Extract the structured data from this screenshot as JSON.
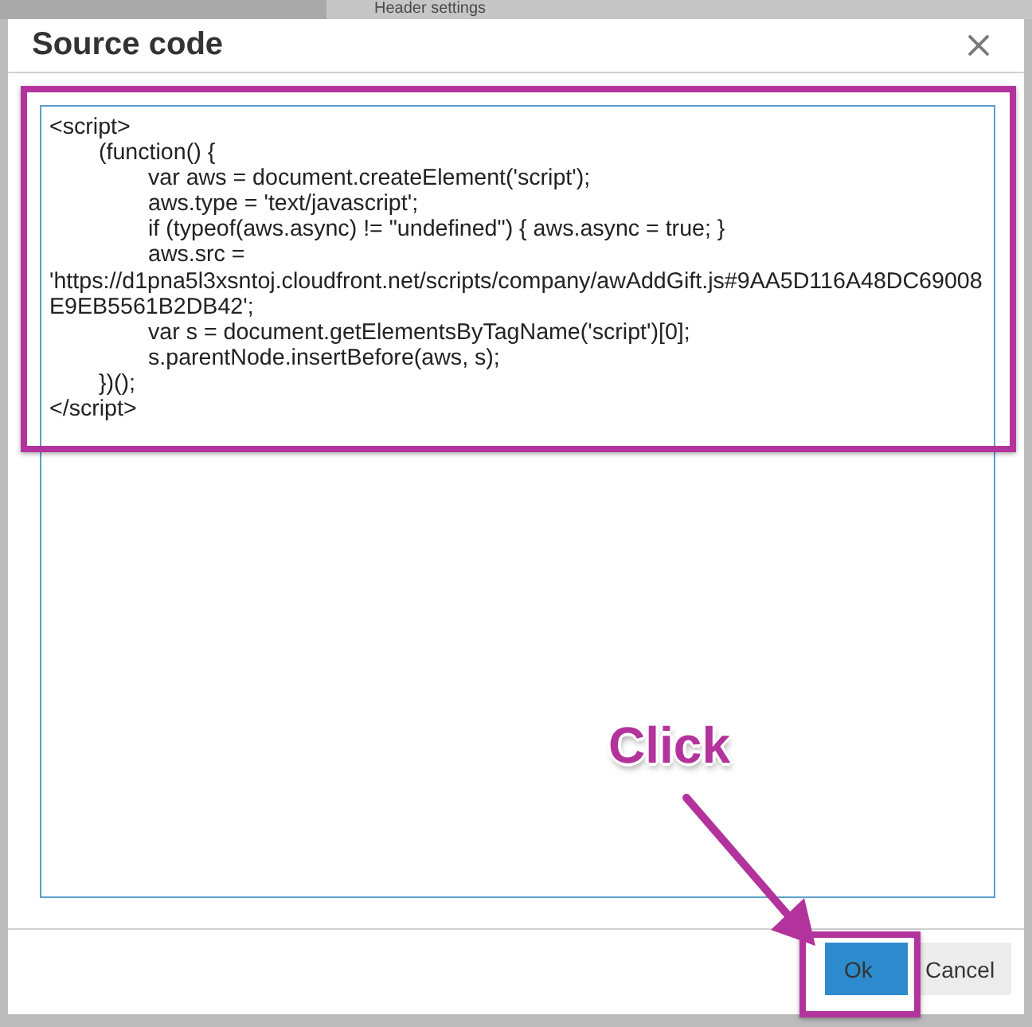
{
  "background": {
    "title": "Header settings"
  },
  "dialog": {
    "title": "Source code",
    "code": "<script>\n\t(function() {\n\t\tvar aws = document.createElement('script');\n\t\taws.type = 'text/javascript';\n\t\tif (typeof(aws.async) != \"undefined\") { aws.async = true; }\n\t\taws.src = 'https://d1pna5l3xsntoj.cloudfront.net/scripts/company/awAddGift.js#9AA5D116A48DC69008E9EB5561B2DB42';\n\t\tvar s = document.getElementsByTagName('script')[0];\n\t\ts.parentNode.insertBefore(aws, s);\n\t})();\n</script>",
    "code_highlighted": true,
    "buttons": [
      {
        "label": "Ok",
        "kind": "primary",
        "highlighted": true
      },
      {
        "label": "Cancel",
        "kind": "secondary",
        "highlighted": false
      }
    ]
  },
  "annotations": [
    {
      "kind": "label",
      "text": "Click"
    },
    {
      "kind": "arrow"
    }
  ]
}
